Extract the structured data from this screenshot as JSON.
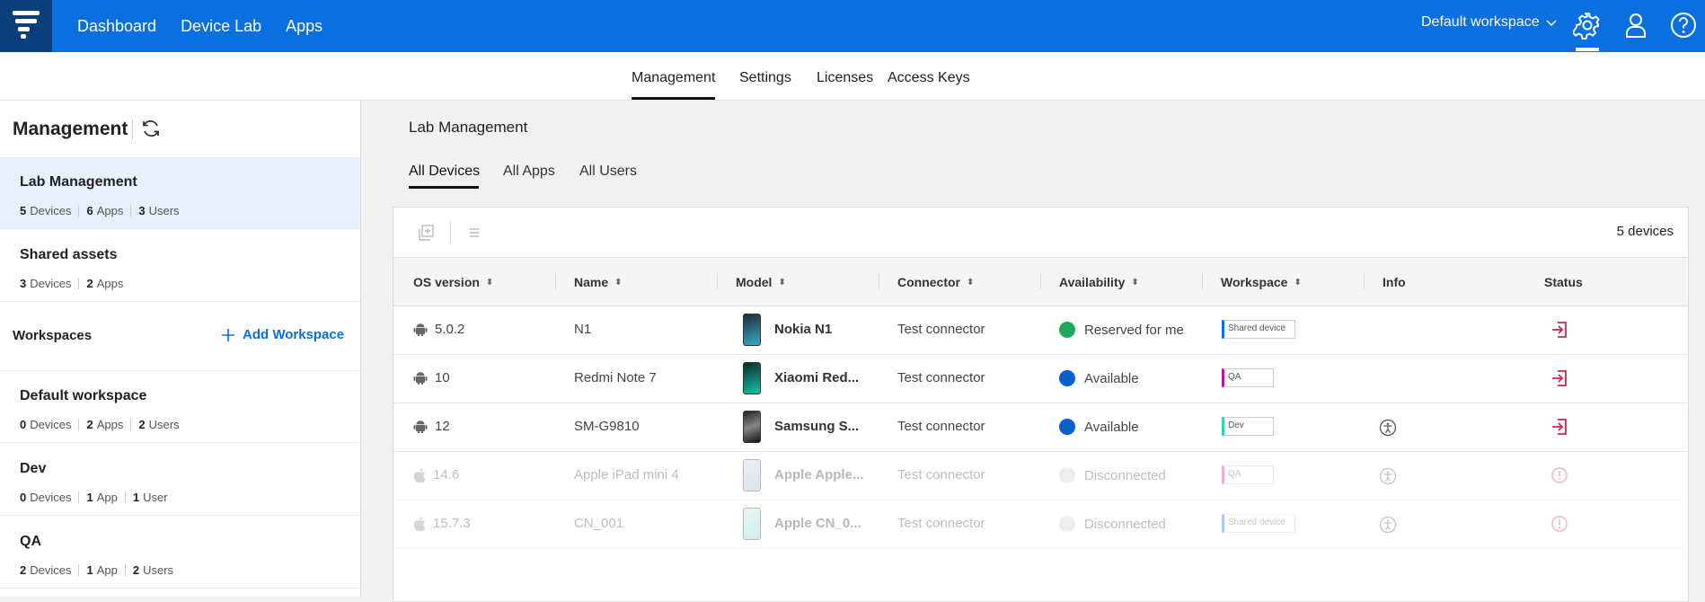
{
  "topbar": {
    "nav": [
      "Dashboard",
      "Device Lab",
      "Apps"
    ],
    "workspace": "Default workspace",
    "brand_color": "#0a6fdf",
    "icons": [
      "logo-icon",
      "chevron-down-icon",
      "gear-icon",
      "user-icon",
      "help-icon"
    ]
  },
  "subtabs": [
    "Management",
    "Settings",
    "Licenses",
    "Access Keys"
  ],
  "sidebar": {
    "title": "Management",
    "items": [
      {
        "title": "Lab Management",
        "meta": [
          [
            "5",
            "Devices"
          ],
          [
            "6",
            "Apps"
          ],
          [
            "3",
            "Users"
          ]
        ],
        "active": true
      },
      {
        "title": "Shared assets",
        "meta": [
          [
            "3",
            "Devices"
          ],
          [
            "2",
            "Apps"
          ]
        ]
      }
    ],
    "workspaces_label": "Workspaces",
    "add_workspace": "Add Workspace",
    "workspaces": [
      {
        "title": "Default workspace",
        "meta": [
          [
            "0",
            "Devices"
          ],
          [
            "2",
            "Apps"
          ],
          [
            "2",
            "Users"
          ]
        ]
      },
      {
        "title": "Dev",
        "meta": [
          [
            "0",
            "Devices"
          ],
          [
            "1",
            "App"
          ],
          [
            "1",
            "User"
          ]
        ]
      },
      {
        "title": "QA",
        "meta": [
          [
            "2",
            "Devices"
          ],
          [
            "1",
            "App"
          ],
          [
            "2",
            "Users"
          ]
        ]
      }
    ]
  },
  "main": {
    "title": "Lab Management",
    "tabs": [
      "All Devices",
      "All Apps",
      "All Users"
    ],
    "device_count": "5 devices",
    "columns": [
      "OS version",
      "Name",
      "Model",
      "Connector",
      "Availability",
      "Workspace",
      "Info",
      "Status"
    ],
    "rows": [
      {
        "os": "5.0.2",
        "platform": "android",
        "name": "N1",
        "model": "Nokia N1",
        "connector": "Test connector",
        "availability": "Reserved for me",
        "dot": "#1fa855",
        "workspace": "Shared device",
        "ws_color": "#0a6fdf",
        "info": false,
        "status": "enter",
        "disabled": false
      },
      {
        "os": "10",
        "platform": "android",
        "name": "Redmi Note 7",
        "model": "Xiaomi Red...",
        "connector": "Test connector",
        "availability": "Available",
        "dot": "#0a5fce",
        "workspace": "QA",
        "ws_color": "#c0169a",
        "info": false,
        "status": "enter",
        "disabled": false
      },
      {
        "os": "12",
        "platform": "android",
        "name": "SM-G9810",
        "model": "Samsung S...",
        "connector": "Test connector",
        "availability": "Available",
        "dot": "#0a5fce",
        "workspace": "Dev",
        "ws_color": "#2fd1b0",
        "info": true,
        "status": "enter",
        "disabled": false
      },
      {
        "os": "14.6",
        "platform": "apple",
        "name": "Apple iPad mini 4",
        "model": "Apple Apple...",
        "connector": "Test connector",
        "availability": "Disconnected",
        "dot": "#cfcfcf",
        "workspace": "QA",
        "ws_color": "#c0169a",
        "info": true,
        "status": "warning",
        "disabled": true
      },
      {
        "os": "15.7.3",
        "platform": "apple",
        "name": "CN_001",
        "model": "Apple CN_0...",
        "connector": "Test connector",
        "availability": "Disconnected",
        "dot": "#cfcfcf",
        "workspace": "Shared device",
        "ws_color": "#0a6fdf",
        "info": true,
        "status": "warning",
        "disabled": true
      }
    ]
  }
}
